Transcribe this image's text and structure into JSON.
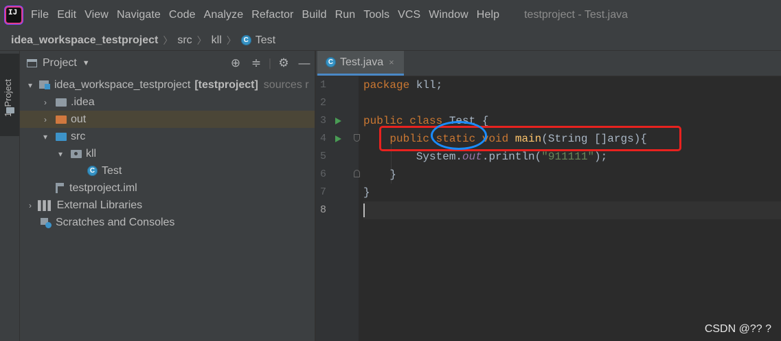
{
  "app": {
    "logo_text": "IJ",
    "window_title": "testproject - Test.java"
  },
  "menu": [
    "File",
    "Edit",
    "View",
    "Navigate",
    "Code",
    "Analyze",
    "Refactor",
    "Build",
    "Run",
    "Tools",
    "VCS",
    "Window",
    "Help"
  ],
  "breadcrumb": {
    "project": "idea_workspace_testproject",
    "src": "src",
    "package": "kll",
    "file": "Test"
  },
  "side_strip": {
    "tab_label": "1: Project"
  },
  "project_panel": {
    "title": "Project",
    "tree": {
      "root": {
        "label": "idea_workspace_testproject",
        "module": "[testproject]",
        "suffix": "sources r"
      },
      "idea": "idea",
      "out": "out",
      "src": "src",
      "kll": "kll",
      "test": "Test",
      "iml": "testproject.iml",
      "libs": "External Libraries",
      "scratches": "Scratches and Consoles"
    }
  },
  "editor": {
    "tab_label": "Test.java",
    "tab_close": "×",
    "line_numbers": [
      "1",
      "2",
      "3",
      "4",
      "5",
      "6",
      "7",
      "8"
    ],
    "current_line": 8,
    "code": {
      "l1_kw": "package",
      "l1_rest": " kll;",
      "l3_kw": "public class",
      "l3_rest": " Test {",
      "l4_kw1": "    public",
      "l4_kw2": " static",
      "l4_kw3": " void",
      "l4_fn": " main",
      "l4_rest": "(String []args){",
      "l5_a": "        System.",
      "l5_fld": "out",
      "l5_b": ".println(",
      "l5_str": "\"911111\"",
      "l5_c": ");",
      "l6": "    }",
      "l7": "}"
    }
  },
  "watermark": "CSDN @?? ?",
  "colors": {
    "background": "#2b2b2b",
    "panel": "#3c3f41",
    "keyword": "#cc7832",
    "function": "#ffc66d",
    "string": "#6a8759",
    "field": "#9876aa",
    "highlight_box": "#e8221f",
    "highlight_ellipse": "#1a8cff"
  }
}
